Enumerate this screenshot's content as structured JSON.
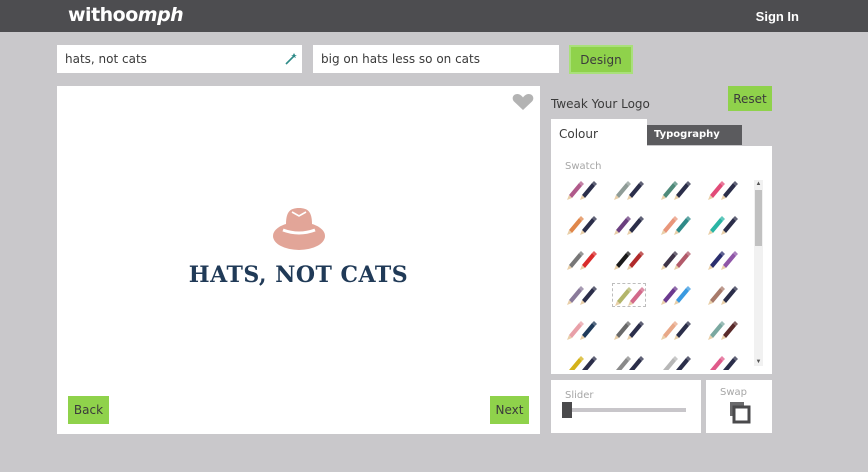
{
  "header": {
    "brand_prefix": "withoo",
    "brand_suffix": "mph",
    "signin_label": "Sign In"
  },
  "inputs": {
    "name_value": "hats, not cats",
    "tagline_value": "big on hats less so on cats",
    "design_label": "Design"
  },
  "canvas": {
    "logo_text": "HATS, NOT CATS",
    "back_label": "Back",
    "next_label": "Next"
  },
  "sidebar": {
    "title": "Tweak Your Logo",
    "reset_label": "Reset",
    "tabs": [
      "Colour",
      "Typography"
    ],
    "swatch_label": "Swatch",
    "slider_label": "Slider",
    "slider_value": 0,
    "swap_label": "Swap",
    "swatches": [
      [
        "#b05a8a",
        "#2b2e4a"
      ],
      [
        "#8f9c97",
        "#2b2e4a"
      ],
      [
        "#4f8a7a",
        "#2b2e4a"
      ],
      [
        "#e14b78",
        "#2b2e4a"
      ],
      [
        "#e0874b",
        "#2b2e4a"
      ],
      [
        "#6b3f7f",
        "#2b2e4a"
      ],
      [
        "#e8967a",
        "#2f8a88"
      ],
      [
        "#2ab5a5",
        "#2b2e4a"
      ],
      [
        "#777777",
        "#d92b2b"
      ],
      [
        "#1a1a1a",
        "#b02a2a"
      ],
      [
        "#3e3448",
        "#b25a6a"
      ],
      [
        "#2a2e6e",
        "#8f56a8"
      ],
      [
        "#8a7a9a",
        "#2b2e4a"
      ],
      [
        "#b3b56a",
        "#d26a8a"
      ],
      [
        "#6b3a8f",
        "#3a9ae0"
      ],
      [
        "#a87a6a",
        "#2b2e4a"
      ],
      [
        "#e8a0a8",
        "#1f3a5a"
      ],
      [
        "#6a6a6a",
        "#2b2e4a"
      ],
      [
        "#e8a888",
        "#2b2e4a"
      ],
      [
        "#7aa8a0",
        "#5a2a2a"
      ],
      [
        "#d4b21a",
        "#2b2e4a"
      ],
      [
        "#8a8a8a",
        "#2b2e4a"
      ],
      [
        "#b7b7b7",
        "#2b2e4a"
      ],
      [
        "#e05a8a",
        "#2b2e4a"
      ]
    ],
    "selected_swatch": 13
  }
}
